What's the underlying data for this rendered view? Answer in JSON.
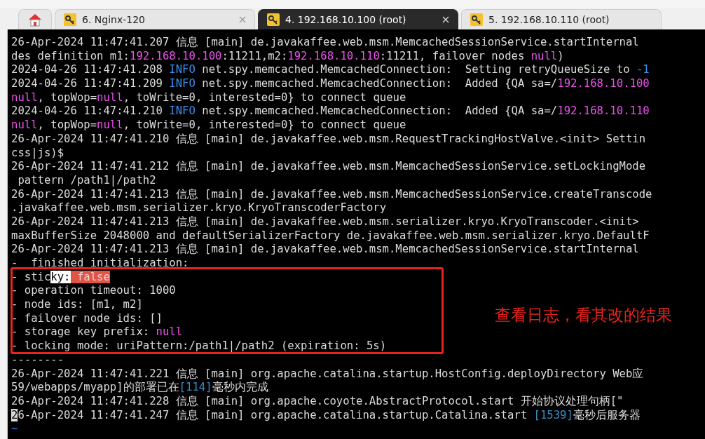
{
  "tabs": [
    {
      "kind": "home",
      "selected": false
    },
    {
      "kind": "session",
      "label": "6. Nginx-120",
      "closable": true,
      "selected": false
    },
    {
      "kind": "session",
      "label": "4. 192.168.10.100 (root)",
      "closable": true,
      "selected": true
    },
    {
      "kind": "session",
      "label": "5. 192.168.10.110 (root)",
      "closable": false,
      "selected": false
    }
  ],
  "terminal": {
    "lines": [
      [
        {
          "kind": "plain",
          "text": "26-Apr-2024 11:47:41.207 信息 [main] de.javakaffee.web.msm.MemcachedSessionService.startInternal"
        }
      ],
      [
        {
          "kind": "plain",
          "text": "des definition m1:"
        },
        {
          "kind": "ip",
          "text": "192.168.10.100"
        },
        {
          "kind": "plain",
          "text": ":11211,m2:"
        },
        {
          "kind": "ip",
          "text": "192.168.10.110"
        },
        {
          "kind": "plain",
          "text": ":11211, failover nodes "
        },
        {
          "kind": "ip",
          "text": "null"
        },
        {
          "kind": "plain",
          "text": ")"
        }
      ],
      [
        {
          "kind": "plain",
          "text": "2024-04-26 11:47:41.208 "
        },
        {
          "kind": "info",
          "text": "INFO"
        },
        {
          "kind": "plain",
          "text": " net.spy.memcached.MemcachedConnection:  Setting retryQueueSize to "
        },
        {
          "kind": "info",
          "text": "-1"
        }
      ],
      [
        {
          "kind": "plain",
          "text": "2024-04-26 11:47:41.209 "
        },
        {
          "kind": "info",
          "text": "INFO"
        },
        {
          "kind": "plain",
          "text": " net.spy.memcached.MemcachedConnection:  Added {QA sa=/"
        },
        {
          "kind": "ip",
          "text": "192.168.10.100"
        }
      ],
      [
        {
          "kind": "ip",
          "text": "null"
        },
        {
          "kind": "plain",
          "text": ", topWop="
        },
        {
          "kind": "ip",
          "text": "null"
        },
        {
          "kind": "plain",
          "text": ", toWrite=0, interested=0} to connect queue"
        }
      ],
      [
        {
          "kind": "plain",
          "text": "2024-04-26 11:47:41.210 "
        },
        {
          "kind": "info",
          "text": "INFO"
        },
        {
          "kind": "plain",
          "text": " net.spy.memcached.MemcachedConnection:  Added {QA sa=/"
        },
        {
          "kind": "ip",
          "text": "192.168.10.110"
        }
      ],
      [
        {
          "kind": "ip",
          "text": "null"
        },
        {
          "kind": "plain",
          "text": ", topWop="
        },
        {
          "kind": "ip",
          "text": "null"
        },
        {
          "kind": "plain",
          "text": ", toWrite=0, interested=0} to connect queue"
        }
      ],
      [
        {
          "kind": "plain",
          "text": "26-Apr-2024 11:47:41.210 信息 [main] de.javakaffee.web.msm.RequestTrackingHostValve.<init> Settin"
        }
      ],
      [
        {
          "kind": "plain",
          "text": "css|js)$"
        }
      ],
      [
        {
          "kind": "plain",
          "text": "26-Apr-2024 11:47:41.212 信息 [main] de.javakaffee.web.msm.MemcachedSessionService.setLockingMode"
        }
      ],
      [
        {
          "kind": "plain",
          "text": " pattern /path1|/path2"
        }
      ],
      [
        {
          "kind": "plain",
          "text": "26-Apr-2024 11:47:41.213 信息 [main] de.javakaffee.web.msm.MemcachedSessionService.createTranscode"
        }
      ],
      [
        {
          "kind": "plain",
          "text": ".javakaffee.web.msm.serializer.kryo.KryoTranscoderFactory"
        }
      ],
      [
        {
          "kind": "plain",
          "text": "26-Apr-2024 11:47:41.213 信息 [main] de.javakaffee.web.msm.serializer.kryo.KryoTranscoder.<init>"
        }
      ],
      [
        {
          "kind": "plain",
          "text": "maxBufferSize 2048000 and defaultSerializerFactory de.javakaffee.web.msm.serializer.kryo.DefaultF"
        }
      ],
      [
        {
          "kind": "plain",
          "text": "26-Apr-2024 11:47:41.213 信息 [main] de.javakaffee.web.msm.MemcachedSessionService.startInternal"
        }
      ],
      [
        {
          "kind": "plain",
          "text": "-  finished initialization:"
        }
      ],
      [
        {
          "kind": "plain",
          "text": "- stic"
        },
        {
          "kind": "selected",
          "text": "ky:"
        },
        {
          "kind": "marked",
          "text": " false"
        }
      ],
      [
        {
          "kind": "plain",
          "text": "- operation timeout: 1000"
        }
      ],
      [
        {
          "kind": "plain",
          "text": "- node ids: [m1, m2]"
        }
      ],
      [
        {
          "kind": "plain",
          "text": "- failover node ids: []"
        }
      ],
      [
        {
          "kind": "plain",
          "text": "- storage key prefix: "
        },
        {
          "kind": "ip",
          "text": "null"
        }
      ],
      [
        {
          "kind": "plain",
          "text": "- locking mode: uriPattern:/path1|/path2 (expiration: 5s)"
        }
      ],
      [
        {
          "kind": "plain",
          "text": "--------"
        }
      ],
      [
        {
          "kind": "plain",
          "text": "26-Apr-2024 11:47:41.221 信息 [main] org.apache.catalina.startup.HostConfig.deployDirectory Web应"
        }
      ],
      [
        {
          "kind": "plain",
          "text": "59/webapps/myapp]的部署已在"
        },
        {
          "kind": "num",
          "text": "[114]"
        },
        {
          "kind": "plain",
          "text": "毫秒内完成"
        }
      ],
      [
        {
          "kind": "plain",
          "text": "26-Apr-2024 11:47:41.228 信息 [main] org.apache.coyote.AbstractProtocol.start 开始协议处理句柄[\""
        }
      ],
      [
        {
          "kind": "cursor",
          "text": "2"
        },
        {
          "kind": "plain",
          "text": "6-Apr-2024 11:47:41.247 信息 [main] org.apache.catalina.startup.Catalina.start "
        },
        {
          "kind": "num",
          "text": "[1539]"
        },
        {
          "kind": "plain",
          "text": "毫秒后服务器"
        }
      ],
      [
        {
          "kind": "tilde",
          "text": "~"
        }
      ]
    ]
  },
  "annotation": {
    "text": "查看日志，看其改的结果"
  }
}
